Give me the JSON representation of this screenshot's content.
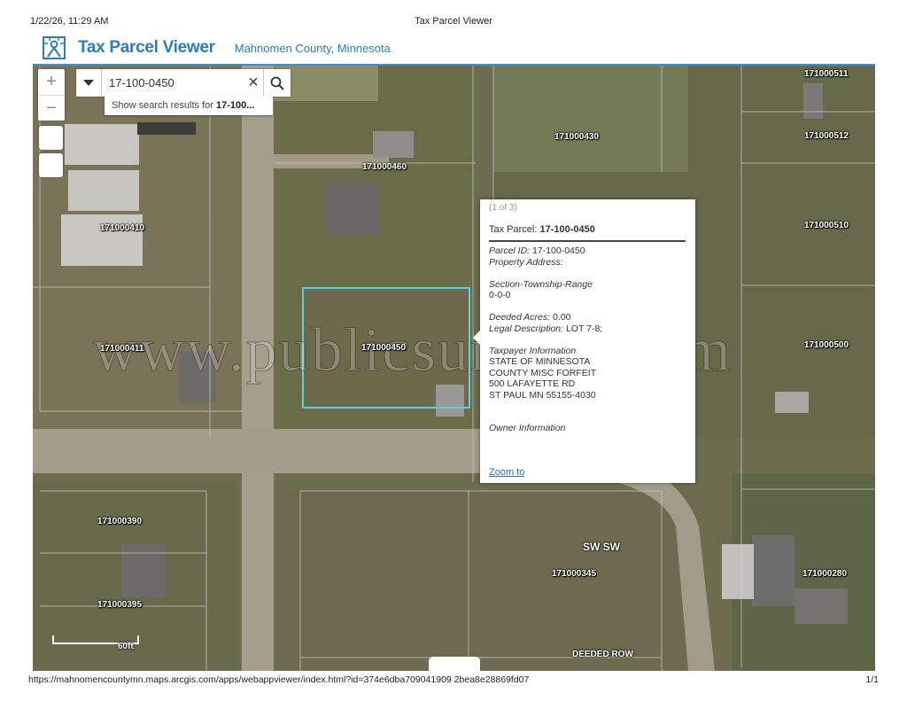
{
  "print_header": {
    "date": "1/22/26, 11:29 AM",
    "title": "Tax Parcel Viewer"
  },
  "app": {
    "title": "Tax Parcel Viewer",
    "subtitle": "Mahnomen County, Minnesota",
    "accent": "#2c7bc7"
  },
  "map": {
    "zoom_in": "+",
    "zoom_out": "−",
    "search": {
      "value": "17-100-0450",
      "suggestion_prefix": "Show search results for ",
      "suggestion_bold": "17-100..."
    },
    "parcels": [
      "171000511",
      "171000430",
      "171000512",
      "171000460",
      "171000410",
      "171000510",
      "171000450",
      "171000411",
      "171000500",
      "171000390",
      "171000345",
      "171000280",
      "171000395"
    ],
    "roads": [
      "SW SW",
      "DEEDED ROW"
    ],
    "selected_outline": "#5ecfe0",
    "scale_label": "60ft",
    "watermark": "www.publicsurplus.com"
  },
  "popup": {
    "count": "(1 of 3)",
    "title_label": "Tax Parcel: ",
    "title_value": "17-100-0450",
    "parcel_id_label": "Parcel ID:",
    "parcel_id": " 17-100-0450",
    "property_address_label": "Property Address:",
    "str_label": "Section-Township-Range",
    "str_value": "0-0-0",
    "deeded_acres_label": "Deeded Acres:",
    "deeded_acres": " 0.00",
    "legal_label": "Legal Description:",
    "legal": " LOT 7-8;",
    "taxpayer_label": "Taxpayer Information",
    "taxpayer_lines": [
      "STATE OF MINNESOTA",
      "COUNTY MISC FORFEIT",
      "500 LAFAYETTE RD",
      "ST PAUL MN 55155-4030"
    ],
    "owner_label": "Owner Information",
    "zoom_to": "Zoom to"
  },
  "print_footer": {
    "url": "https://mahnomencountymn.maps.arcgis.com/apps/webappviewer/index.html?id=374e6dba709041909 2bea8e28869fd07",
    "page": "1/1"
  }
}
